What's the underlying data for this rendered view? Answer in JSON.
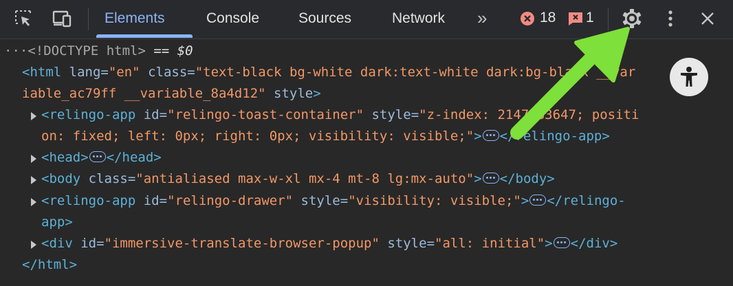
{
  "toolbar": {
    "tabs": [
      {
        "label": "Elements",
        "active": true
      },
      {
        "label": "Console",
        "active": false
      },
      {
        "label": "Sources",
        "active": false
      },
      {
        "label": "Network",
        "active": false
      }
    ],
    "more_tabs_glyph": "»",
    "error_count": "18",
    "warning_count": "1",
    "icons": [
      "inspect-element-icon",
      "device-toolbar-icon",
      "more-tabs-icon",
      "error-icon",
      "issues-icon",
      "settings-gear-icon",
      "more-options-icon",
      "close-icon"
    ],
    "accent_color": "#8ab4f8",
    "error_color": "#f28b82"
  },
  "doctype": {
    "text": "<!DOCTYPE html>",
    "eq": " == ",
    "var": "$0"
  },
  "tree": {
    "html_open_line1": {
      "tag": "<html",
      "a1": " lang",
      "eq1": "=",
      "v1": "\"en\"",
      "a2": " class",
      "eq2": "=",
      "v2": "\"text-black bg-white dark:text-white dark:bg-black __var"
    },
    "html_open_line2": {
      "v2cont": "iable_ac79ff __variable_8a4d12\"",
      "a3": " style",
      "close": ">"
    },
    "toast": {
      "tag": "<relingo-app",
      "a1": " id",
      "eq": "=",
      "v1": "\"relingo-toast-container\"",
      "a2": " style",
      "eq2": "=",
      "v2a": "\"z-index: 2147483647; positi",
      "v2b": "on: fixed; left: 0px; right: 0px; visibility: visible;\"",
      "close": ">",
      "end": "</relingo-app>"
    },
    "head": {
      "open": "<head>",
      "close": "</head>"
    },
    "body": {
      "tag": "<body",
      "a1": " class",
      "eq": "=",
      "v1": "\"antialiased max-w-xl mx-4 mt-8 lg:mx-auto\"",
      "close": ">",
      "end": "</body>"
    },
    "drawer": {
      "tag": "<relingo-app",
      "a1": " id",
      "eq": "=",
      "v1": "\"relingo-drawer\"",
      "a2": " style",
      "eq2": "=",
      "v2": "\"visibility: visible;\"",
      "close": ">",
      "end": "</relingo-",
      "end2": "app>"
    },
    "div": {
      "tag": "<div",
      "a1": " id",
      "eq": "=",
      "v1": "\"immersive-translate-browser-popup\"",
      "a2": " style",
      "eq2": "=",
      "v2": "\"all: initial\"",
      "close": ">",
      "end": "</div>"
    },
    "html_close": "</html>"
  },
  "annotation": {
    "arrow_color": "#7ee03a",
    "points_to": "settings-gear-icon"
  }
}
